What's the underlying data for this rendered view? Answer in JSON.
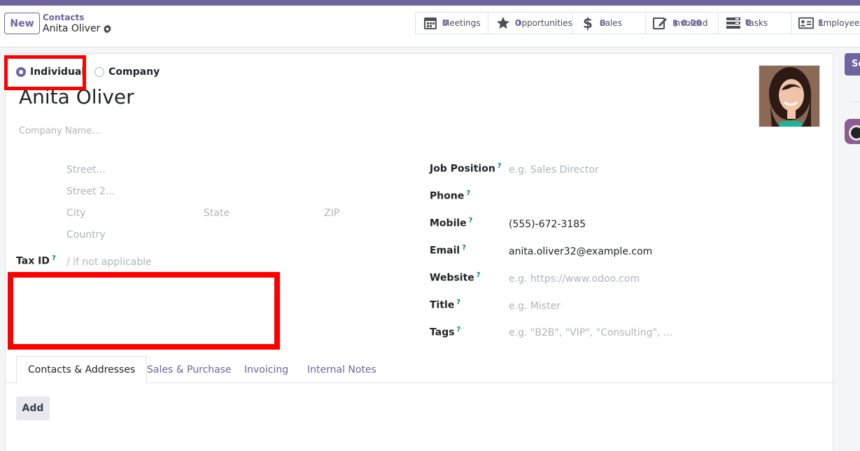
{
  "header": {
    "new_label": "New",
    "breadcrumb_parent": "Contacts",
    "breadcrumb_current": "Anita Oliver"
  },
  "stats": [
    {
      "label": "Meetings",
      "value": "0",
      "icon": "calendar-icon"
    },
    {
      "label": "Opportunities",
      "value": "0",
      "icon": "star-icon"
    },
    {
      "label": "Sales",
      "value": "0",
      "icon": "dollar-icon"
    },
    {
      "label": "Invoiced",
      "value": "$ 0.00",
      "icon": "edit-invoice-icon"
    },
    {
      "label": "Tasks",
      "value": "0",
      "icon": "tasks-icon"
    },
    {
      "label": "Employee",
      "value": "1",
      "icon": "id-card-icon"
    }
  ],
  "side": {
    "button_label": "Se"
  },
  "form": {
    "type_individual": "Individual",
    "type_company": "Company",
    "name": "Anita Oliver",
    "company_placeholder": "Company Name...",
    "street_placeholder": "Street...",
    "street2_placeholder": "Street 2...",
    "city_placeholder": "City",
    "state_placeholder": "State",
    "zip_placeholder": "ZIP",
    "country_placeholder": "Country",
    "taxid_label": "Tax ID",
    "taxid_placeholder": "/ if not applicable",
    "job_label": "Job Position",
    "job_placeholder": "e.g. Sales Director",
    "phone_label": "Phone",
    "mobile_label": "Mobile",
    "mobile_value": "(555)-672-3185",
    "email_label": "Email",
    "email_value": "anita.oliver32@example.com",
    "website_label": "Website",
    "website_placeholder": "e.g. https://www.odoo.com",
    "title_label": "Title",
    "title_placeholder": "e.g. Mister",
    "tags_label": "Tags",
    "tags_placeholder": "e.g. \"B2B\", \"VIP\", \"Consulting\", ...",
    "help_mark": "?"
  },
  "tabs": [
    "Contacts & Addresses",
    "Sales & Purchase",
    "Invoicing",
    "Internal Notes"
  ],
  "add_label": "Add",
  "colors": {
    "brand": "#71639e",
    "highlight": "#ff0000",
    "help": "#017e84"
  }
}
